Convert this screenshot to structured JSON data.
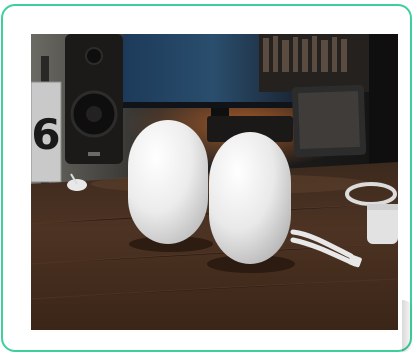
{
  "image": {
    "subject": "two-white-mesh-router-units-on-desk",
    "sticker_text": "6"
  },
  "colors": {
    "frame_border": "#3fcf9a",
    "desk": "#4a3121",
    "router": "#eeeeee"
  }
}
